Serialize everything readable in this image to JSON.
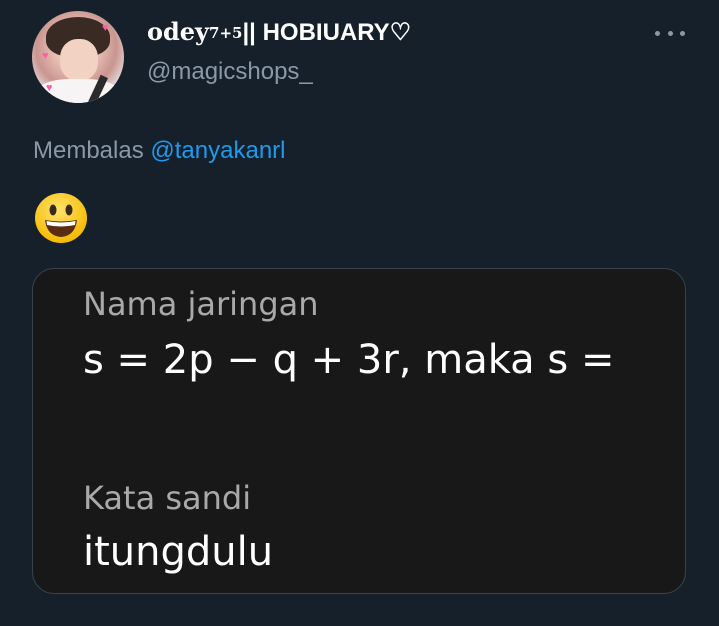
{
  "tweet": {
    "author": {
      "display_name_styled": "odey",
      "display_name_superscript": "7+5",
      "display_name_rest": "|| HOBIUARY♡",
      "handle": "@magicshops_"
    },
    "more_icon": "more-horizontal-icon",
    "reply": {
      "prefix": "Membalas",
      "mention": "@tanyakanrl"
    },
    "emoji": "😃",
    "media": {
      "network_label": "Nama jaringan",
      "network_value": "s = 2p − q + 3r, maka s =",
      "password_label": "Kata sandi",
      "password_value": "itungdulu"
    }
  },
  "colors": {
    "background": "#15202b",
    "secondary_text": "#8b98a5",
    "link": "#1d9bf0",
    "media_background": "#181818"
  }
}
